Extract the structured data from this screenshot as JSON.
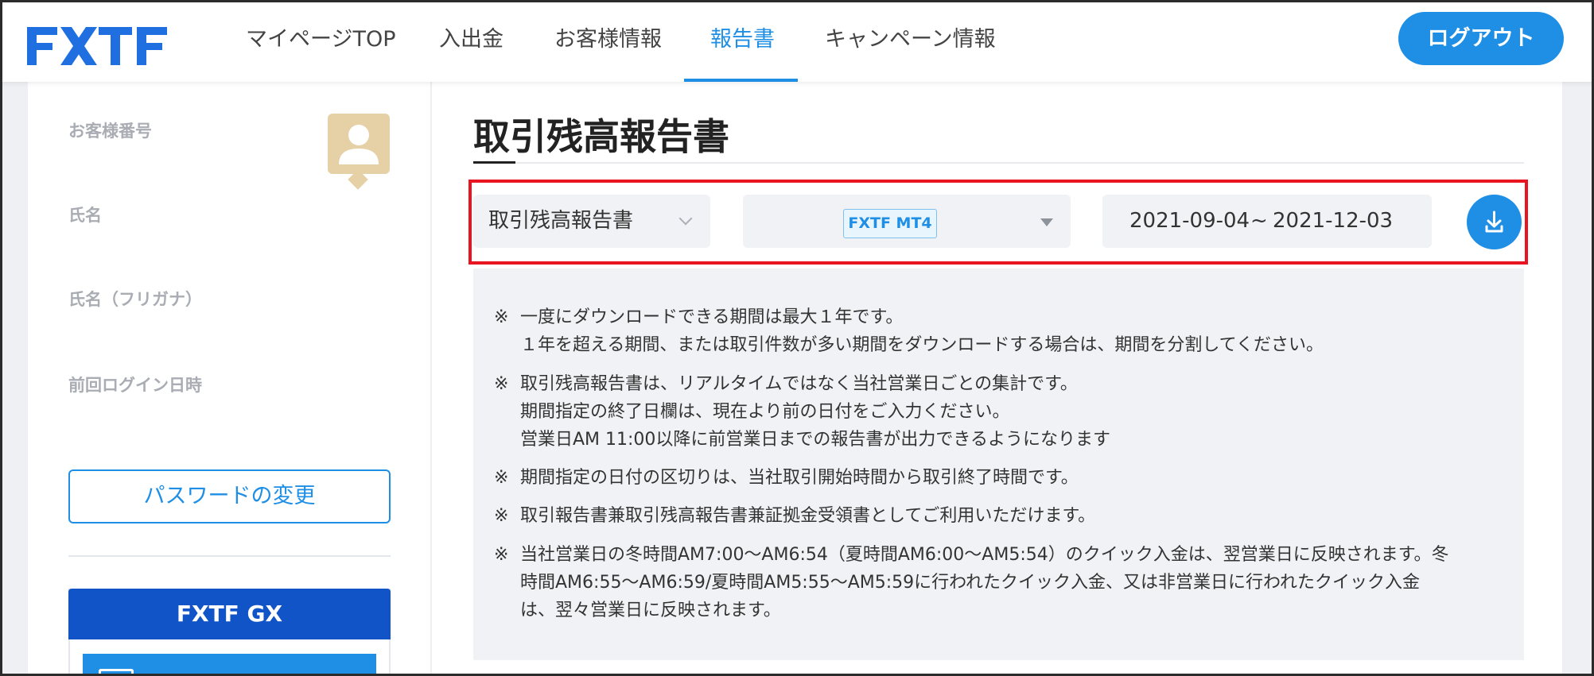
{
  "header": {
    "logo_text": "FXTF",
    "nav": [
      {
        "label": "マイページTOP"
      },
      {
        "label": "入出金"
      },
      {
        "label": "お客様情報"
      },
      {
        "label": "報告書"
      },
      {
        "label": "キャンペーン情報"
      }
    ],
    "logout_label": "ログアウト",
    "accent_color": "#1f8fe6",
    "highlight_color": "#e8141f"
  },
  "sidebar": {
    "customer_number_label": "お客様番号",
    "name_label": "氏名",
    "name_kana_label": "氏名（フリガナ）",
    "last_login_label": "前回ログイン日時",
    "password_button": "パスワードの変更",
    "gx_title": "FXTF GX"
  },
  "main": {
    "title": "取引残高報告書",
    "report_type": "取引残高報告書",
    "account": "FXTF MT4",
    "date_from": "2021-09-04",
    "date_sep": "~",
    "date_to": "2021-12-03",
    "notes": [
      {
        "mark": "※",
        "lines": [
          "一度にダウンロードできる期間は最大１年です。",
          "１年を超える期間、または取引件数が多い期間をダウンロードする場合は、期間を分割してください。"
        ]
      },
      {
        "mark": "※",
        "lines": [
          "取引残高報告書は、リアルタイムではなく当社営業日ごとの集計です。",
          "期間指定の終了日欄は、現在より前の日付をご入力ください。",
          "営業日AM 11:00以降に前営業日までの報告書が出力できるようになります"
        ]
      },
      {
        "mark": "※",
        "lines": [
          "期間指定の日付の区切りは、当社取引開始時間から取引終了時間です。"
        ]
      },
      {
        "mark": "※",
        "lines": [
          "取引報告書兼取引残高報告書兼証拠金受領書としてご利用いただけます。"
        ]
      },
      {
        "mark": "※",
        "lines": [
          "当社営業日の冬時間AM7:00〜AM6:54（夏時間AM6:00〜AM5:54）のクイック入金は、翌営業日に反映されます。冬",
          "時間AM6:55〜AM6:59/夏時間AM5:55〜AM5:59に行われたクイック入金、又は非営業日に行われたクイック入金",
          "は、翌々営業日に反映されます。"
        ]
      }
    ]
  }
}
